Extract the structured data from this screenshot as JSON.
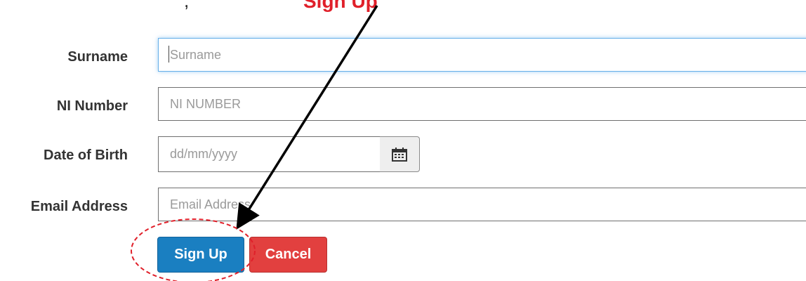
{
  "top_text": {
    "partial_left": ",",
    "partial_red": "Sign Up"
  },
  "form": {
    "surname": {
      "label": "Surname",
      "placeholder": "Surname"
    },
    "ni_number": {
      "label": "NI Number",
      "placeholder": "NI NUMBER"
    },
    "dob": {
      "label": "Date of Birth",
      "placeholder": "dd/mm/yyyy",
      "calendar_icon": "calendar-icon"
    },
    "email": {
      "label": "Email Address",
      "placeholder": "Email Address"
    }
  },
  "buttons": {
    "signup": "Sign Up",
    "cancel": "Cancel"
  },
  "colors": {
    "signup_bg": "#1a7fc1",
    "cancel_bg": "#e2403f",
    "annotation_red": "#e0202a",
    "focus_border": "#66afe9"
  },
  "annotations": {
    "arrow": "black-arrow",
    "highlight": "red-dashed-ellipse"
  }
}
